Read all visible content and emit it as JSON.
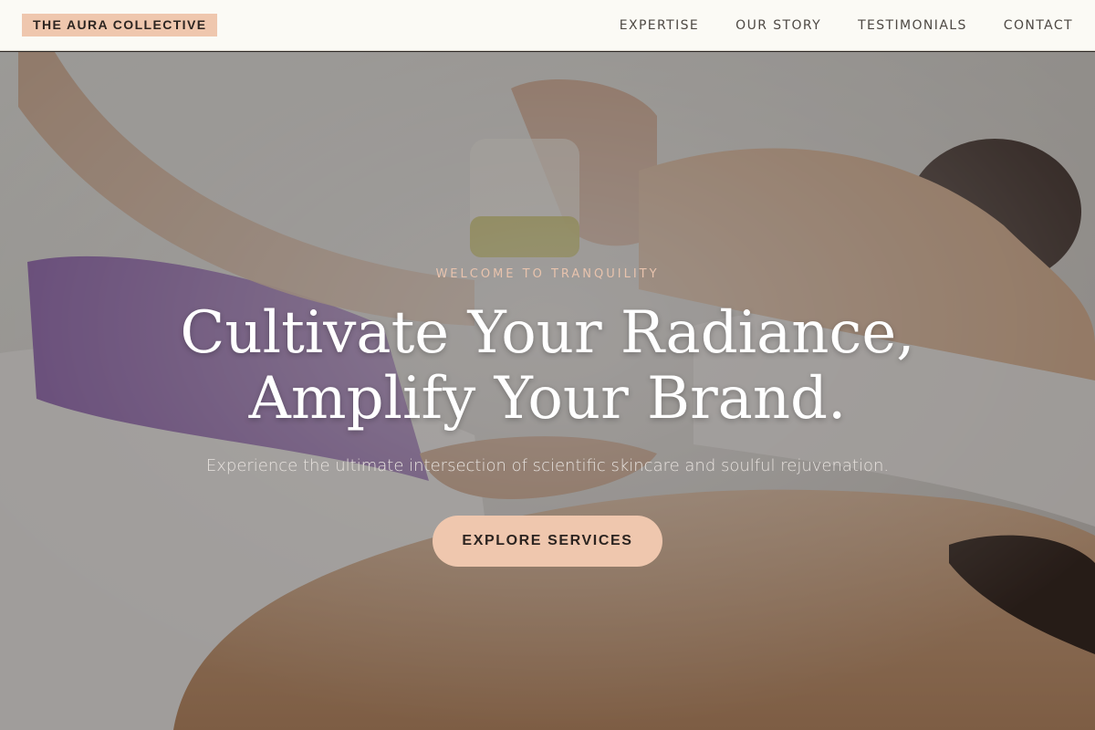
{
  "brand": {
    "logo_text": "THE AURA COLLECTIVE",
    "accent": "#efc7ae"
  },
  "nav": {
    "items": [
      {
        "label": "EXPERTISE"
      },
      {
        "label": "OUR STORY"
      },
      {
        "label": "TESTIMONIALS"
      },
      {
        "label": "CONTACT"
      }
    ]
  },
  "hero": {
    "eyebrow": "WELCOME TO TRANQUILITY",
    "headline_line1": "Cultivate Your Radiance,",
    "headline_line2": "Amplify Your Brand.",
    "subtitle": "Experience the ultimate intersection of scientific skincare and soulful rejuvenation.",
    "cta_label": "EXPLORE SERVICES",
    "background_image": "spa-massage-photo"
  }
}
